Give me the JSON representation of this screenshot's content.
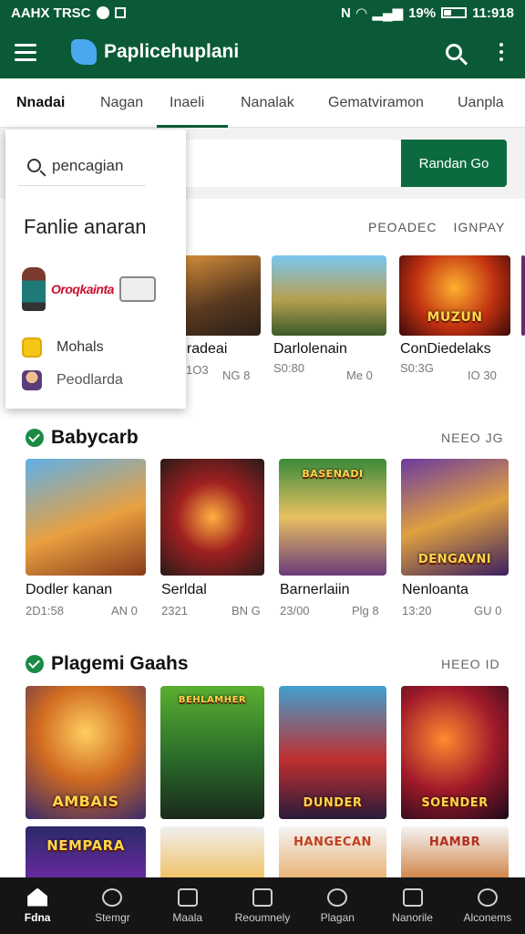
{
  "status_bar": {
    "left_text": "AAHX TRSC",
    "battery": "19%",
    "time": "11:918"
  },
  "app": {
    "title": "Paplicehuplani"
  },
  "tabs": [
    {
      "label": "Nnadai"
    },
    {
      "label": "Nagan"
    },
    {
      "label": "Inaeli"
    },
    {
      "label": "Nanalak"
    },
    {
      "label": "Gematviramon"
    },
    {
      "label": "Uanpla"
    }
  ],
  "search": {
    "go_label": "Randan Go"
  },
  "popup": {
    "search_text": "pencagian",
    "title": "Fanlie anaran",
    "brand_text": "Oroqkainta",
    "items": [
      {
        "label": "Mohals"
      },
      {
        "label": "Peodlarda"
      }
    ]
  },
  "section_popular": {
    "actions": [
      "PEOADEC",
      "IGNPAY"
    ],
    "tiles": [
      {
        "name": "oradeai",
        "meta": "1O3",
        "meta_right": "NG 8"
      },
      {
        "name": "Darlolenain",
        "meta": "S0:80",
        "meta_right": "Me 0"
      },
      {
        "name": "ConDiedelaks",
        "meta": "S0:3G",
        "meta_right": "IO 30"
      }
    ]
  },
  "section_babycarb": {
    "title": "Babycarb",
    "more": "NEEO JG",
    "tiles": [
      {
        "name": "Dodler kanan",
        "meta": "2D1:58",
        "meta_right": "AN 0"
      },
      {
        "name": "Serldal",
        "meta": "2321",
        "meta_right": "BN G"
      },
      {
        "name": "Barnerlaiin",
        "meta": "23/00",
        "meta_right": "Plg 8"
      },
      {
        "name": "Nenloanta",
        "meta": "13:20",
        "meta_right": "GU 0"
      }
    ],
    "art_labels": [
      "",
      "",
      "BASENADI",
      "DENGAVNI"
    ]
  },
  "section_plagemi": {
    "title": "Plagemi Gaahs",
    "more": "HEEO ID",
    "art_labels": [
      "AMBAIS",
      "BEHLAMHER",
      "DUNDER",
      "SOENDER"
    ],
    "bottom_labels": [
      "NEMPARA",
      "",
      "HANGECAN",
      "HAMBR"
    ]
  },
  "bottom_nav": [
    {
      "label": "Fdna",
      "icon": "home-icon",
      "active": true
    },
    {
      "label": "Stemgr",
      "icon": "search-icon"
    },
    {
      "label": "Maala",
      "icon": "media-icon"
    },
    {
      "label": "Reoumnely",
      "icon": "person-icon"
    },
    {
      "label": "Plagan",
      "icon": "face-icon"
    },
    {
      "label": "Nanorile",
      "icon": "chat-icon"
    },
    {
      "label": "Alconems",
      "icon": "account-icon"
    }
  ],
  "colors": {
    "primary": "#0b5a37",
    "accent": "#0b6b3f",
    "check": "#1a8a45",
    "nav_bg": "#151515"
  }
}
